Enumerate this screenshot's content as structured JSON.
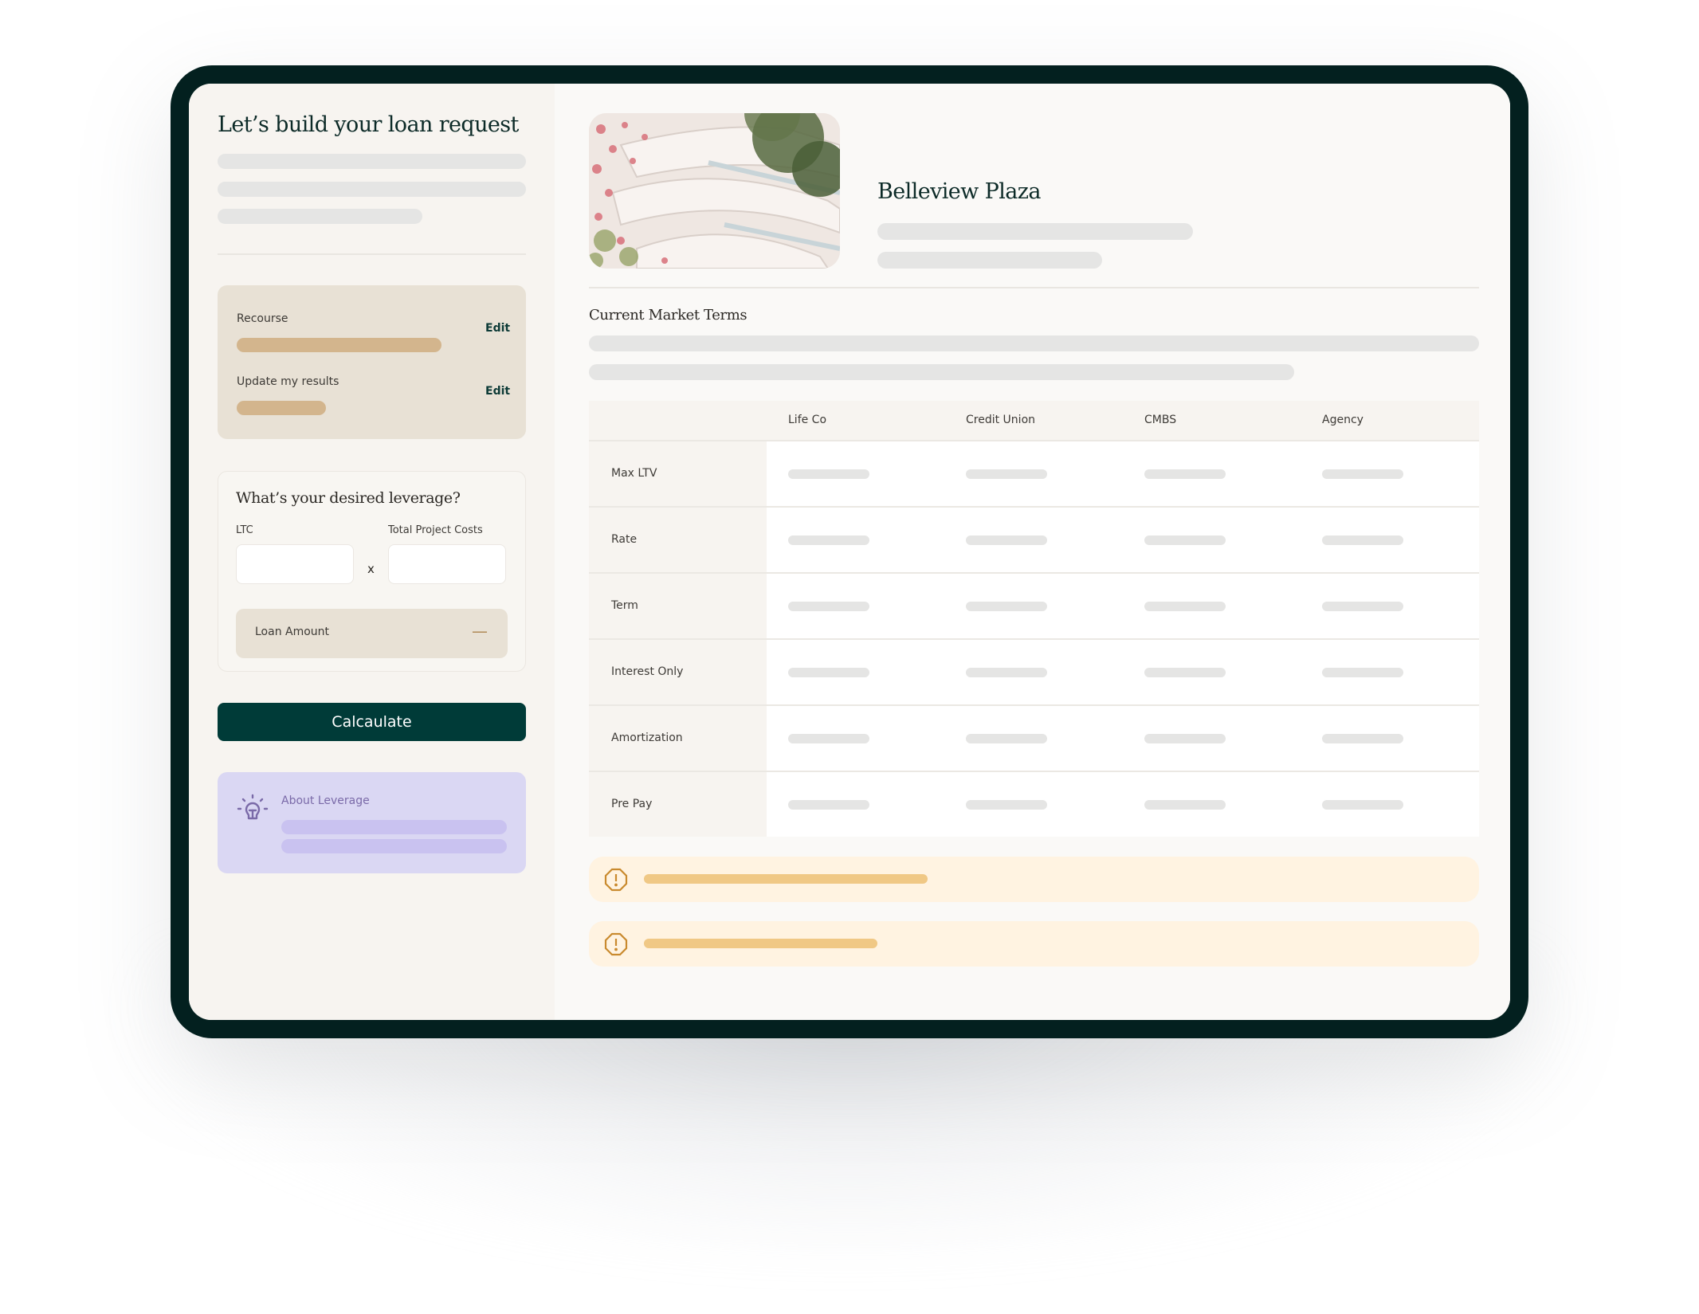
{
  "left_panel": {
    "title": "Let’s build your loan request",
    "summary_card": {
      "items": [
        {
          "label": "Recourse",
          "edit_label": "Edit"
        },
        {
          "label": "Update my results",
          "edit_label": "Edit"
        }
      ]
    },
    "leverage_card": {
      "title": "What’s your desired leverage?",
      "ltc_label": "LTC",
      "ltc_value": "",
      "multiply_symbol": "x",
      "total_costs_label": "Total Project Costs",
      "total_costs_value": "",
      "loan_amount_label": "Loan Amount",
      "loan_amount_value": "—"
    },
    "calculate_label": "Calcaulate",
    "about_card": {
      "icon": "lightbulb-icon",
      "title": "About Leverage"
    }
  },
  "right_panel": {
    "property_name": "Belleview Plaza",
    "property_image": "building-photo",
    "section_title": "Current Market Terms",
    "table": {
      "columns": [
        "",
        "Life Co",
        "Credit Union",
        "CMBS",
        "Agency"
      ],
      "rows": [
        {
          "label": "Max LTV"
        },
        {
          "label": "Rate"
        },
        {
          "label": "Term"
        },
        {
          "label": "Interest Only"
        },
        {
          "label": "Amortization"
        },
        {
          "label": "Pre Pay"
        }
      ]
    },
    "alerts": [
      {
        "icon": "warning-octagon-icon"
      },
      {
        "icon": "warning-octagon-icon"
      }
    ]
  },
  "colors": {
    "frame": "#03201f",
    "primary": "#003b38",
    "beige_card": "#e8e1d5",
    "tan_accent": "#d3b58d",
    "lavender_card": "#dad7f3",
    "warning_bg": "#fff3e1",
    "warning_accent": "#c98a2e"
  }
}
